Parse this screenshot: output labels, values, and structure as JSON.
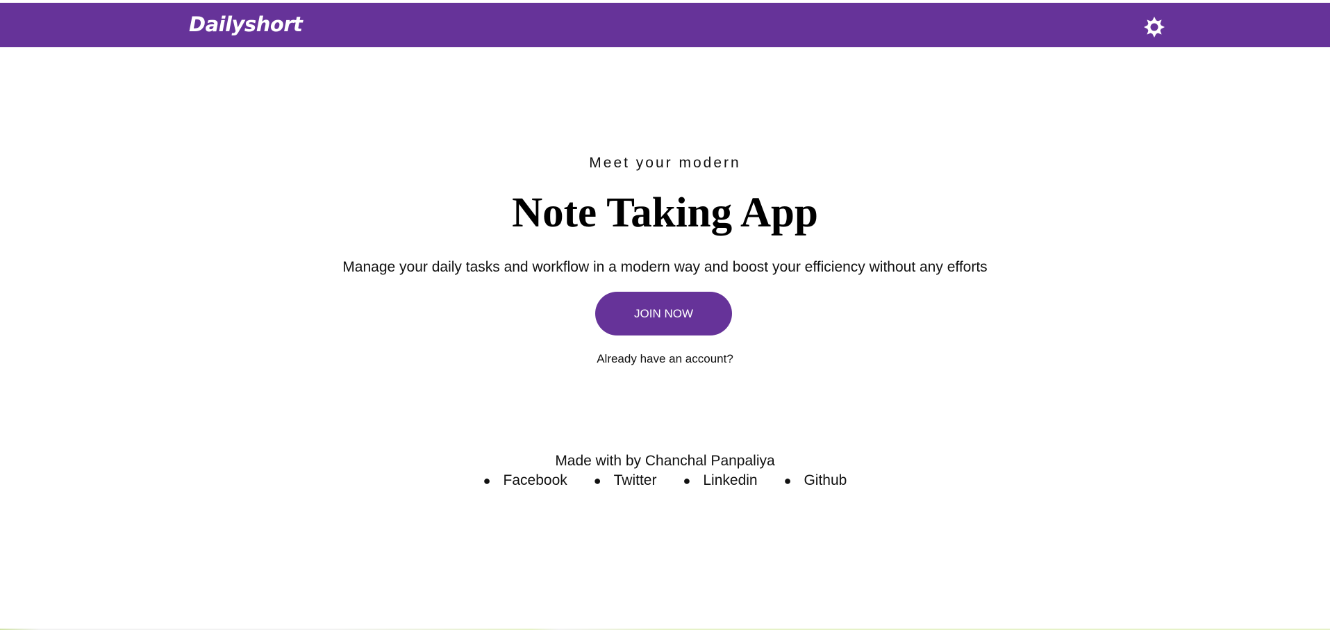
{
  "navbar": {
    "brand": "Dailyshort",
    "theme_toggle_icon": "sun-icon",
    "background_color": "#663399"
  },
  "hero": {
    "eyebrow": "Meet your modern",
    "headline": "Note Taking App",
    "subline": "Manage your daily tasks and workflow in a modern way and boost your efficiency without any efforts",
    "cta_label": "JOIN NOW",
    "login_prompt": "Already have an account?"
  },
  "footer": {
    "credit": "Made with by Chanchal Panpaliya",
    "links": [
      {
        "label": "Facebook"
      },
      {
        "label": "Twitter"
      },
      {
        "label": "Linkedin"
      },
      {
        "label": "Github"
      }
    ]
  },
  "colors": {
    "accent": "#663399",
    "text": "#111111",
    "background": "#ffffff"
  }
}
